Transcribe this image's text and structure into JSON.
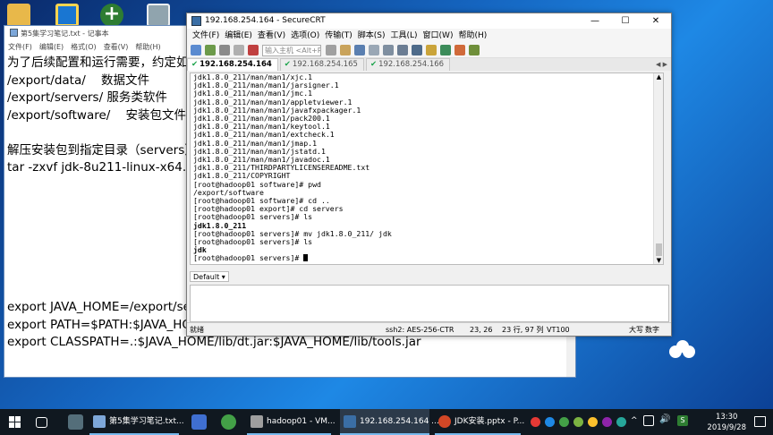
{
  "notepad": {
    "title": "第5集学习笔记.txt - 记事本",
    "menu": [
      "文件(F)",
      "编辑(E)",
      "格式(O)",
      "查看(V)",
      "帮助(H)"
    ],
    "lines": [
      "为了后续配置和运行需要，约定如",
      "/export/data/    数据文件",
      "/export/servers/ 服务类软件",
      "/export/software/    安装包文件",
      "",
      "解压安装包到指定目录（servers）",
      "tar -zxvf jdk-8u211-linux-x64.ta",
      "",
      "",
      "",
      "",
      "",
      "",
      "",
      "export JAVA_HOME=/export/se",
      "export PATH=$PATH:$JAVA_HOME/bin",
      "export CLASSPATH=.:$JAVA_HOME/lib/dt.jar:$JAVA_HOME/lib/tools.jar"
    ]
  },
  "crt": {
    "title": "192.168.254.164 - SecureCRT",
    "window_buttons": [
      "—",
      "☐",
      "✕"
    ],
    "menu": [
      "文件(F)",
      "编辑(E)",
      "查看(V)",
      "选项(O)",
      "传输(T)",
      "脚本(S)",
      "工具(L)",
      "窗口(W)",
      "帮助(H)"
    ],
    "host_input_placeholder": "输入主机 <Alt+R>",
    "tabs": [
      "192.168.254.164",
      "192.168.254.165",
      "192.168.254.166"
    ],
    "tab_check": "✔",
    "tab_nav": "◀ ▶",
    "terminal_lines": [
      {
        "t": "jdk1.8.0_211/man/man1/xjc.1",
        "b": false
      },
      {
        "t": "jdk1.8.0_211/man/man1/jarsigner.1",
        "b": false
      },
      {
        "t": "jdk1.8.0_211/man/man1/jmc.1",
        "b": false
      },
      {
        "t": "jdk1.8.0_211/man/man1/appletviewer.1",
        "b": false
      },
      {
        "t": "jdk1.8.0_211/man/man1/javafxpackager.1",
        "b": false
      },
      {
        "t": "jdk1.8.0_211/man/man1/pack200.1",
        "b": false
      },
      {
        "t": "jdk1.8.0_211/man/man1/keytool.1",
        "b": false
      },
      {
        "t": "jdk1.8.0_211/man/man1/extcheck.1",
        "b": false
      },
      {
        "t": "jdk1.8.0_211/man/man1/jmap.1",
        "b": false
      },
      {
        "t": "jdk1.8.0_211/man/man1/jstatd.1",
        "b": false
      },
      {
        "t": "jdk1.8.0_211/man/man1/javadoc.1",
        "b": false
      },
      {
        "t": "jdk1.8.0_211/THIRDPARTYLICENSEREADME.txt",
        "b": false
      },
      {
        "t": "jdk1.8.0_211/COPYRIGHT",
        "b": false
      },
      {
        "t": "[root@hadoop01 software]# pwd",
        "b": false
      },
      {
        "t": "/export/software",
        "b": false
      },
      {
        "t": "[root@hadoop01 software]# cd ..",
        "b": false
      },
      {
        "t": "[root@hadoop01 export]# cd servers",
        "b": false
      },
      {
        "t": "[root@hadoop01 servers]# ls",
        "b": false
      },
      {
        "t": "jdk1.8.0_211",
        "b": true
      },
      {
        "t": "[root@hadoop01 servers]# mv jdk1.8.0_211/ jdk",
        "b": false
      },
      {
        "t": "[root@hadoop01 servers]# ls",
        "b": false
      },
      {
        "t": "jdk",
        "b": true
      },
      {
        "t": "[root@hadoop01 servers]# ",
        "b": false
      }
    ],
    "command_session": "Default",
    "status": {
      "ready": "就绪",
      "cipher": "ssh2: AES-256-CTR",
      "position": "23,  26",
      "size": "23 行, 97 列",
      "term": "VT100",
      "caps": "大写",
      "num": "数字"
    }
  },
  "taskbar": {
    "tasks": [
      "第5集学习笔记.txt...",
      "hadoop01 - VM...",
      "192.168.254.164 ...",
      "JDK安装.pptx - P..."
    ],
    "time": "13:30",
    "date": "2019/9/28",
    "volume": "🔊"
  }
}
